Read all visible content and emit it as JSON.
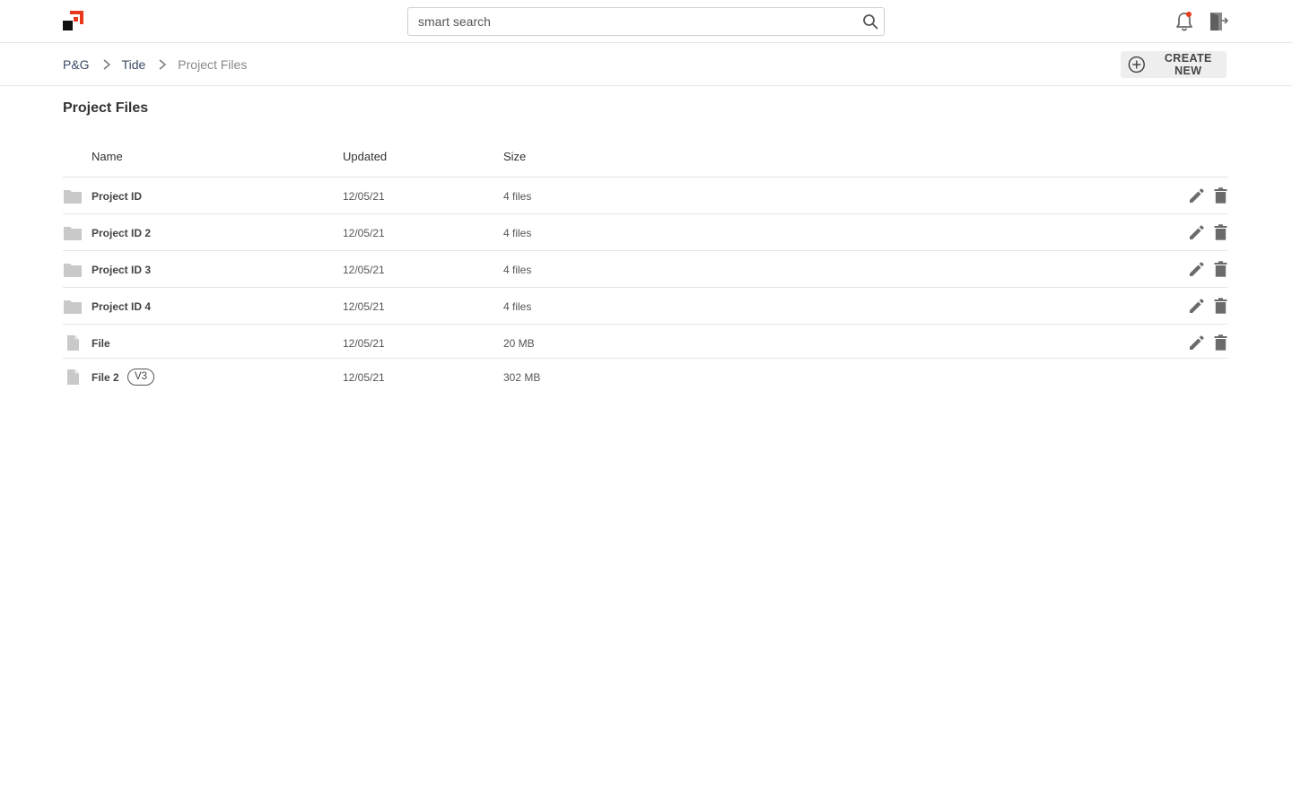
{
  "header": {
    "search_placeholder": "smart search",
    "icons": [
      "logo-icon",
      "search-icon",
      "bell-icon",
      "logout-icon"
    ],
    "notification_dot_color": "#e8381b"
  },
  "breadcrumb": {
    "items": [
      "P&G",
      "Tide"
    ],
    "current": "Project Files"
  },
  "toolbar": {
    "create_label": "CREATE NEW"
  },
  "page": {
    "title": "Project Files"
  },
  "table": {
    "columns": [
      "Name",
      "Updated",
      "Size"
    ],
    "rows": [
      {
        "type": "folder",
        "name": "Project ID",
        "updated": "12/05/21",
        "size": "4 files",
        "actions": true
      },
      {
        "type": "folder",
        "name": "Project ID 2",
        "updated": "12/05/21",
        "size": "4 files",
        "actions": true
      },
      {
        "type": "folder",
        "name": "Project ID 3",
        "updated": "12/05/21",
        "size": "4 files",
        "actions": true
      },
      {
        "type": "folder",
        "name": "Project ID 4",
        "updated": "12/05/21",
        "size": "4 files",
        "actions": true
      },
      {
        "type": "file",
        "name": "File",
        "updated": "12/05/21",
        "size": "20 MB",
        "actions": true
      },
      {
        "type": "file",
        "name": "File 2",
        "version": "V3",
        "updated": "12/05/21",
        "size": "302 MB",
        "actions": false
      }
    ]
  },
  "colors": {
    "brand_red": "#e8381b",
    "brand_black": "#111111",
    "icon_gray": "#6b6b6b",
    "folder_gray": "#c9c9c9"
  }
}
